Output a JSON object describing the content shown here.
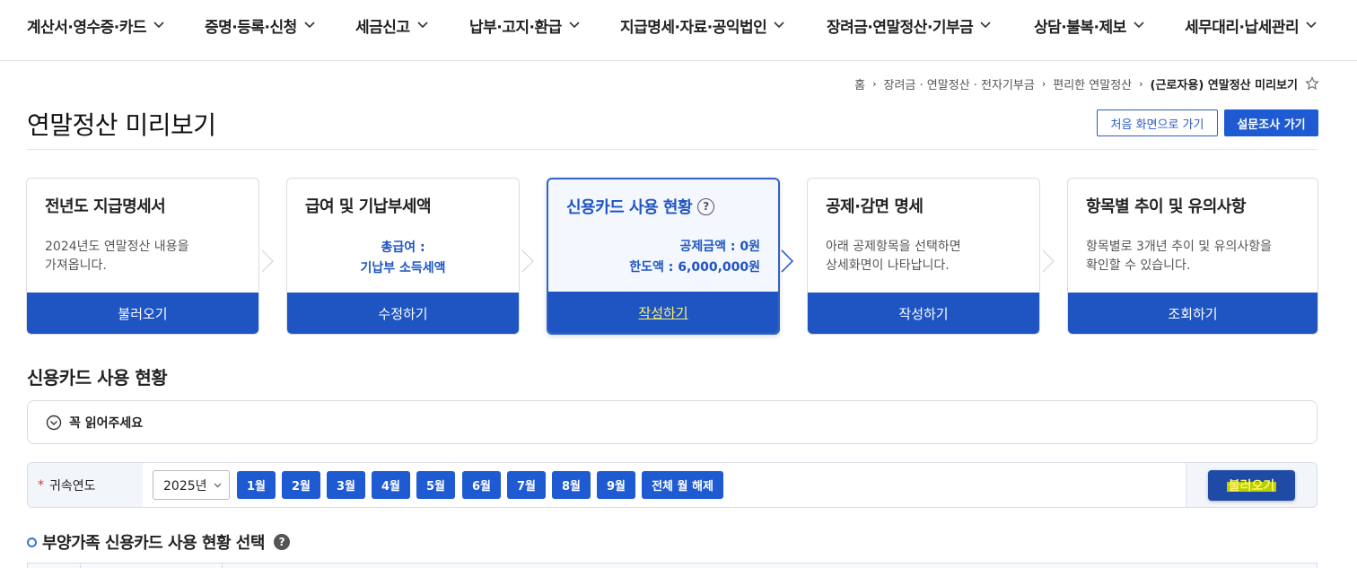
{
  "nav": {
    "items": [
      {
        "label": "계산서·영수증·카드"
      },
      {
        "label": "증명·등록·신청"
      },
      {
        "label": "세금신고"
      },
      {
        "label": "납부·고지·환급"
      },
      {
        "label": "지급명세·자료·공익법인"
      },
      {
        "label": "장려금·연말정산·기부금"
      },
      {
        "label": "상담·불복·제보"
      },
      {
        "label": "세무대리·납세관리"
      }
    ]
  },
  "breadcrumb": {
    "items": [
      "홈",
      "장려금 · 연말정산 · 전자기부금",
      "편리한 연말정산",
      "(근로자용) 연말정산 미리보기"
    ],
    "star_icon": "star-icon"
  },
  "page": {
    "title": "연말정산 미리보기",
    "btn_home": "처음 화면으로 가기",
    "btn_survey": "설문조사 가기"
  },
  "steps": [
    {
      "title": "전년도 지급명세서",
      "desc_line1": "2024년도 연말정산 내용을",
      "desc_line2": "가져옵니다.",
      "button": "불러오기"
    },
    {
      "title": "급여 및 기납부세액",
      "line1": "총급여 :",
      "line2": "기납부 소득세액",
      "button": "수정하기"
    },
    {
      "title": "신용카드 사용 현황",
      "help": "?",
      "line1": "공제금액 : 0원",
      "line2": "한도액 : 6,000,000원",
      "button": "작성하기"
    },
    {
      "title": "공제·감면 명세",
      "desc_line1": "아래 공제항목을 선택하면",
      "desc_line2": "상세화면이 나타납니다.",
      "button": "작성하기"
    },
    {
      "title": "항목별 추이 및 유의사항",
      "desc_line1": "항목별로 3개년 추이 및 유의사항을",
      "desc_line2": "확인할 수 있습니다.",
      "button": "조회하기"
    }
  ],
  "section": {
    "title": "신용카드 사용 현황",
    "notice": "꼭 읽어주세요"
  },
  "filter": {
    "required_mark": "*",
    "label": "귀속연도",
    "year_value": "2025년",
    "months": [
      "1월",
      "2월",
      "3월",
      "4월",
      "5월",
      "6월",
      "7월",
      "8월",
      "9월"
    ],
    "clear_all": "전체 월 해제",
    "load": "불러오기"
  },
  "sub_section": {
    "title": "부양가족 신용카드 사용 현황 선택",
    "help": "?"
  },
  "colors": {
    "primary": "#1e5ad2",
    "card_button": "#1e55c2",
    "highlight_text": "#fff46a"
  }
}
